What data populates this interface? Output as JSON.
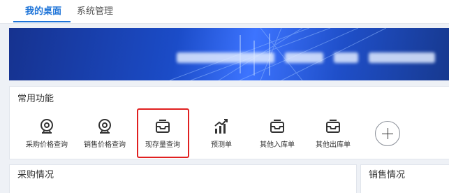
{
  "tabs": [
    {
      "label": "我的桌面",
      "active": true
    },
    {
      "label": "系统管理",
      "active": false
    }
  ],
  "banner": {
    "text": "系"
  },
  "common_functions": {
    "title": "常用功能",
    "items": [
      {
        "label": "采购价格查询",
        "icon": "webcam-icon"
      },
      {
        "label": "销售价格查询",
        "icon": "webcam-icon"
      },
      {
        "label": "现存量查询",
        "icon": "tray-icon",
        "highlighted": true
      },
      {
        "label": "预测单",
        "icon": "bar-chart-icon"
      },
      {
        "label": "其他入库单",
        "icon": "tray-icon"
      },
      {
        "label": "其他出库单",
        "icon": "tray-icon"
      }
    ],
    "add_button": "+"
  },
  "cards": [
    {
      "title": "采购情况"
    },
    {
      "title": "销售情况"
    }
  ],
  "colors": {
    "accent": "#1e74d8",
    "highlight_border": "#e02020",
    "banner": "#1b4cc8"
  }
}
